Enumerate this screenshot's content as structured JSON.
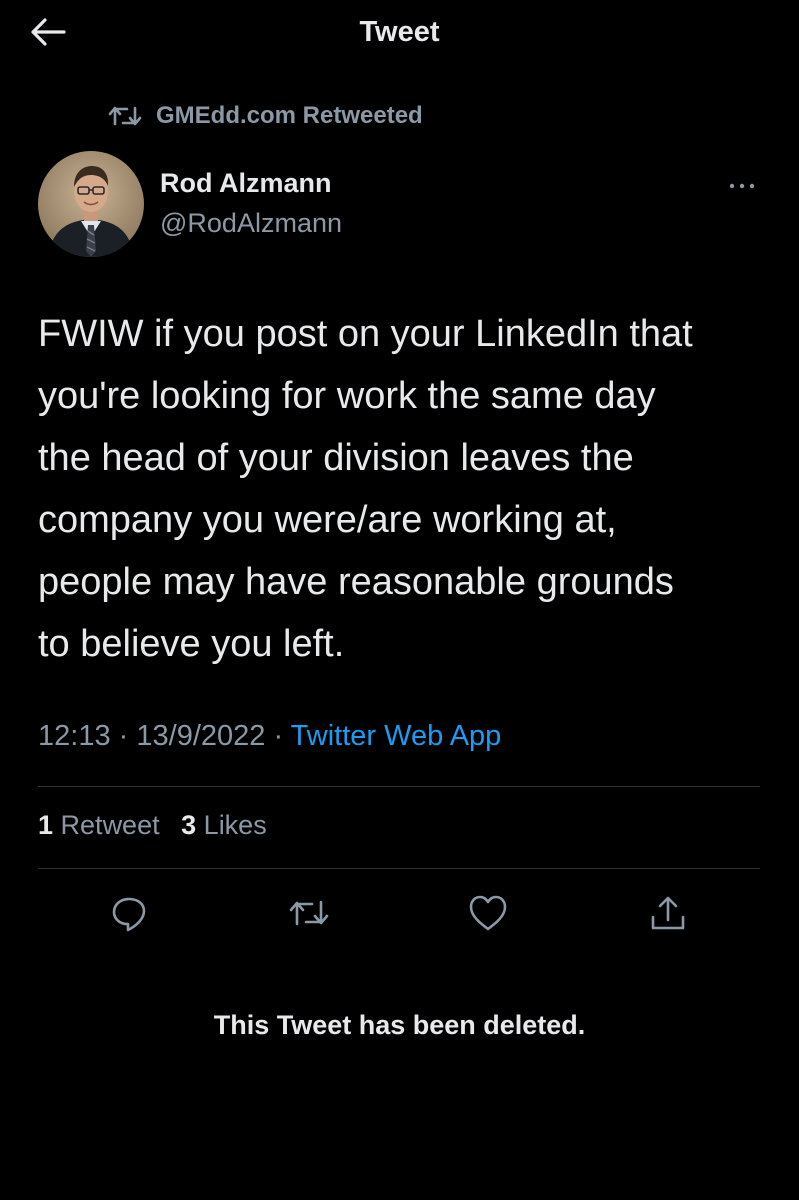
{
  "header": {
    "title": "Tweet",
    "back_icon": "arrow-left-icon"
  },
  "retweet_context": {
    "icon": "retweet-icon",
    "text": "GMEdd.com Retweeted"
  },
  "author": {
    "name": "Rod Alzmann",
    "handle": "@RodAlzmann",
    "avatar_icon": "profile-photo"
  },
  "tweet": {
    "text": "FWIW if you post on your LinkedIn that\nyou're looking for work the same day\nthe head of your division leaves the\ncompany you were/are working at,\npeople may have reasonable grounds\nto believe you left.",
    "time": "12:13",
    "separator": "·",
    "date": "13/9/2022",
    "source": "Twitter Web App"
  },
  "stats": {
    "retweets_count": "1",
    "retweets_label": "Retweet",
    "likes_count": "3",
    "likes_label": "Likes"
  },
  "actions": {
    "reply_icon": "reply-icon",
    "retweet_icon": "retweet-icon",
    "like_icon": "heart-icon",
    "share_icon": "share-icon"
  },
  "deleted_notice": "This Tweet has been deleted.",
  "colors": {
    "background": "#000000",
    "text_primary": "#e7e9ea",
    "text_secondary": "#8b98a5",
    "link": "#1d9bf0",
    "divider": "#2f3336"
  }
}
